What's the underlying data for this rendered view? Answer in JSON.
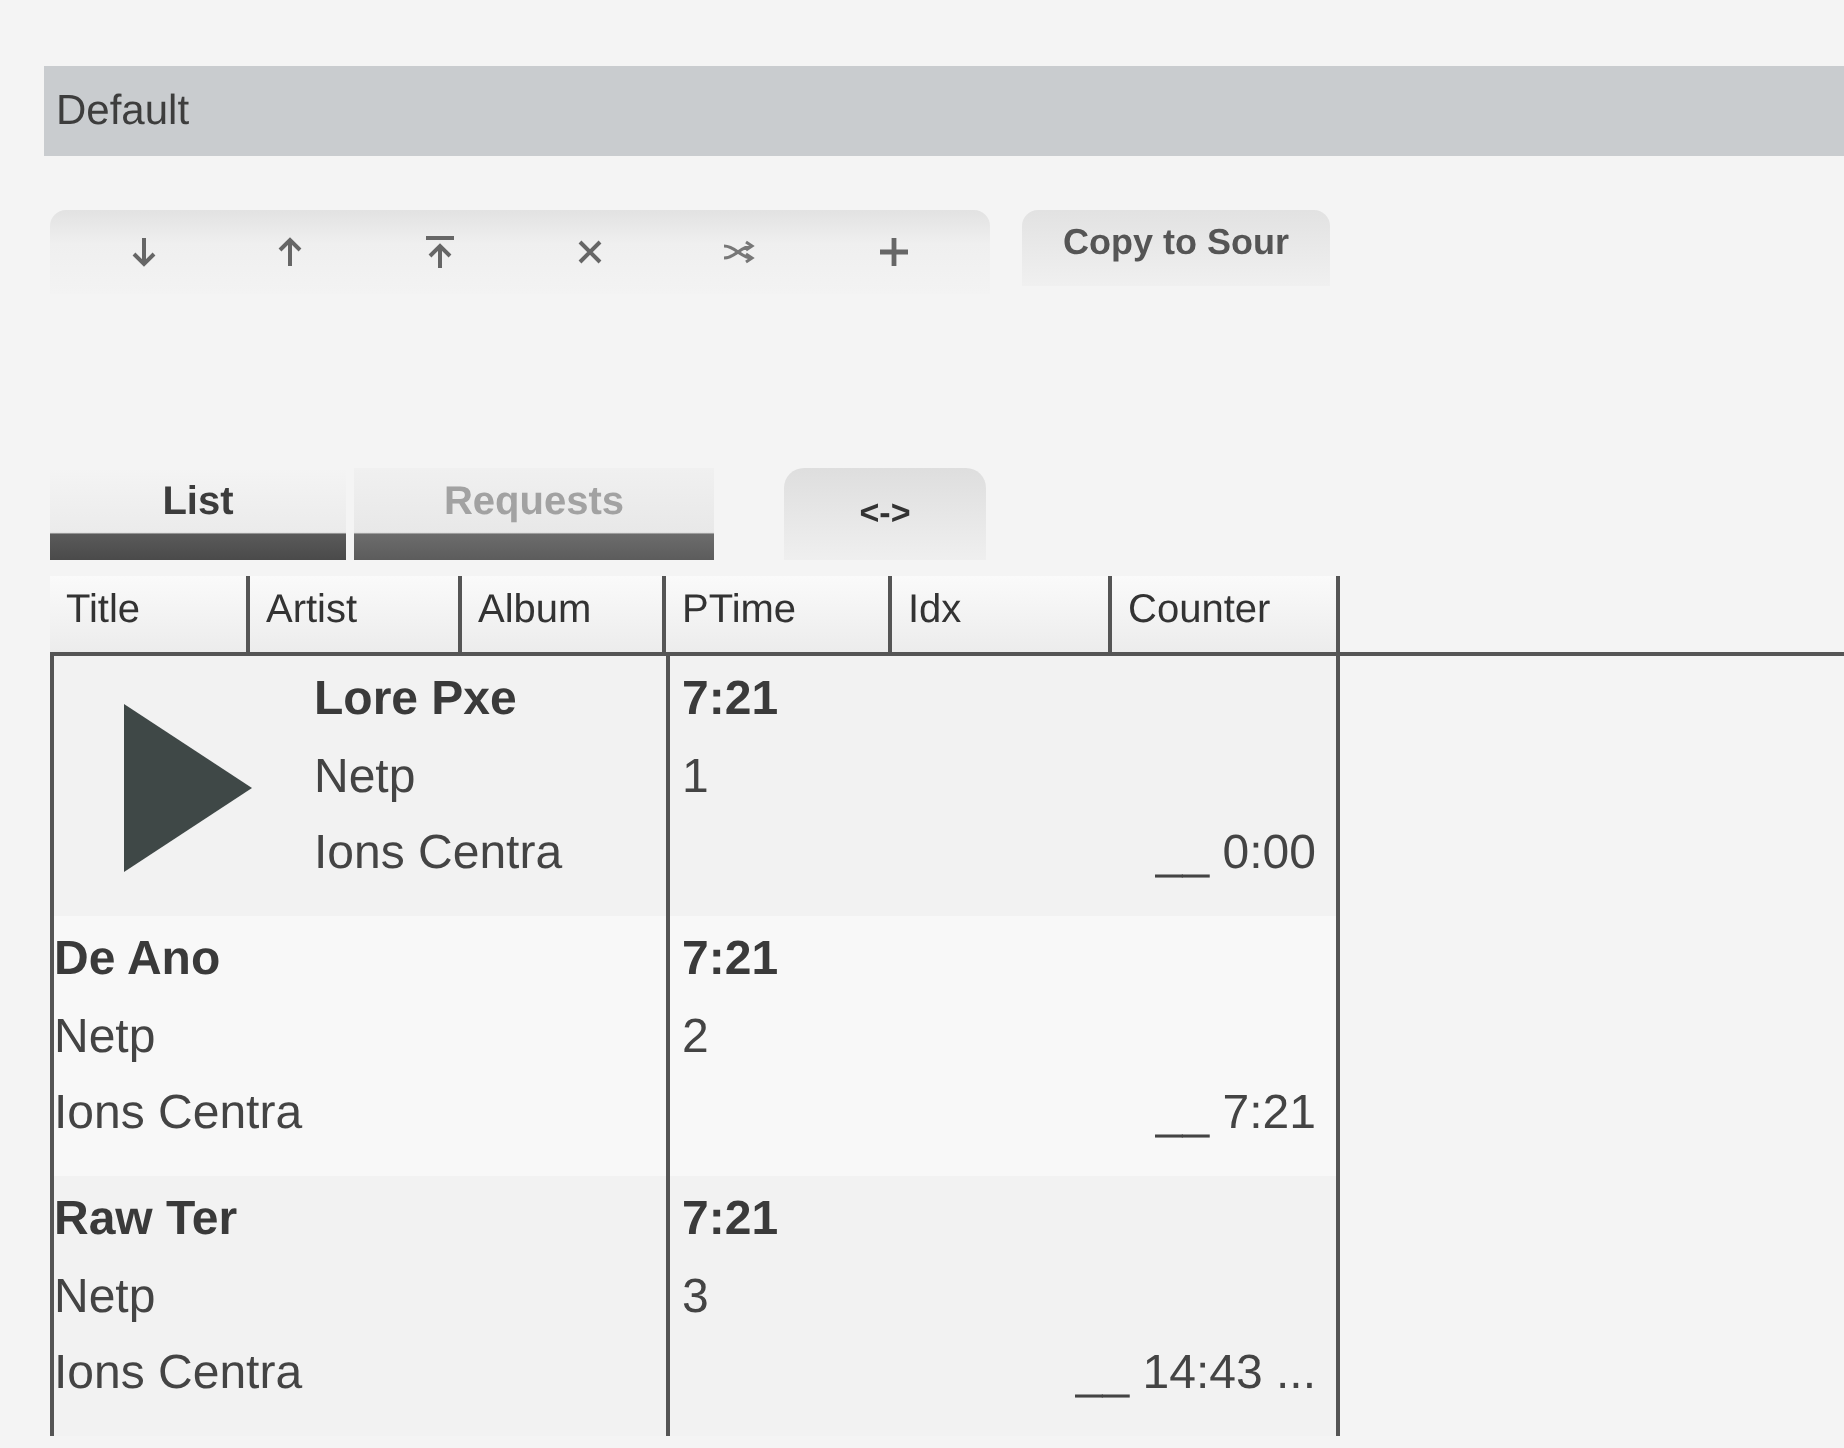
{
  "playlist_title": "Default",
  "toolbar": [
    {
      "kind": "move-down"
    },
    {
      "kind": "move-up"
    },
    {
      "kind": "move-top"
    },
    {
      "kind": "remove"
    },
    {
      "kind": "shuffle"
    },
    {
      "kind": "add"
    }
  ],
  "copy_button": "Copy to Sour",
  "tabs": [
    {
      "label": "List",
      "selected": true,
      "disabled": false
    },
    {
      "label": "Requests",
      "selected": false,
      "disabled": true
    }
  ],
  "swap_button": "<->",
  "table": {
    "columns": [
      "Title",
      "Artist",
      "Album",
      "PTime",
      "Idx",
      "Counter"
    ],
    "rows": [
      {
        "playing": true,
        "title": "Lore Pxe",
        "artist": "Netp",
        "album": "Ions Centra",
        "ptime": "7:21",
        "idx": "1",
        "counter": "__ 0:00"
      },
      {
        "playing": false,
        "title": "De Ano",
        "artist": "Netp",
        "album": "Ions Centra",
        "ptime": "7:21",
        "idx": "2",
        "counter": "__ 7:21"
      },
      {
        "playing": false,
        "title": "Raw Ter",
        "artist": "Netp",
        "album": "Ions Centra",
        "ptime": "7:21",
        "idx": "3",
        "counter": "__ 14:43 ..."
      }
    ]
  }
}
